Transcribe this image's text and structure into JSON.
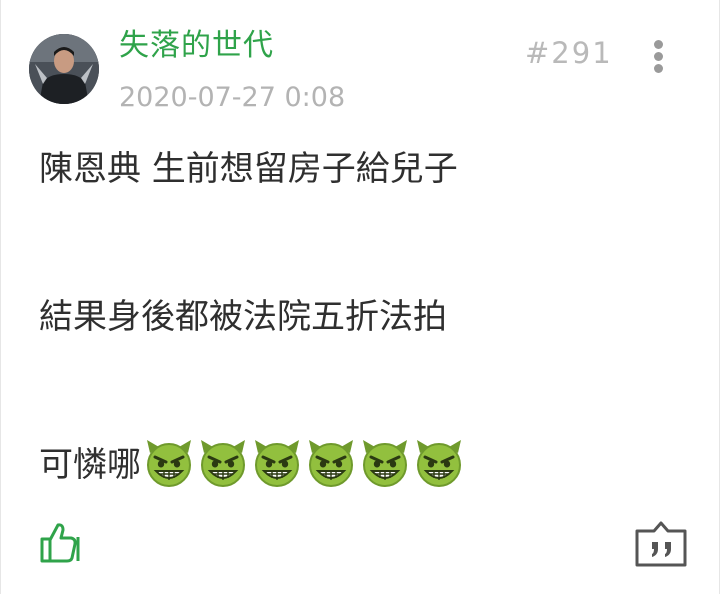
{
  "post": {
    "username": "失落的世代",
    "timestamp": "2020-07-27 0:08",
    "floor": "#291",
    "lines": [
      "陳恩典 生前想留房子給兒子",
      "結果身後都被法院五折法拍",
      "可憐哪"
    ],
    "emoji_name": "smiling-imp-emoji",
    "emoji_count": 6
  },
  "icons": {
    "like": "thumbs-up-icon",
    "reply": "quote-reply-icon",
    "menu": "more-vertical-icon"
  },
  "colors": {
    "username": "#2fa34a",
    "like_icon": "#2fa34a",
    "meta_text": "#b3b3b3",
    "body_text": "#2f2f2f"
  }
}
